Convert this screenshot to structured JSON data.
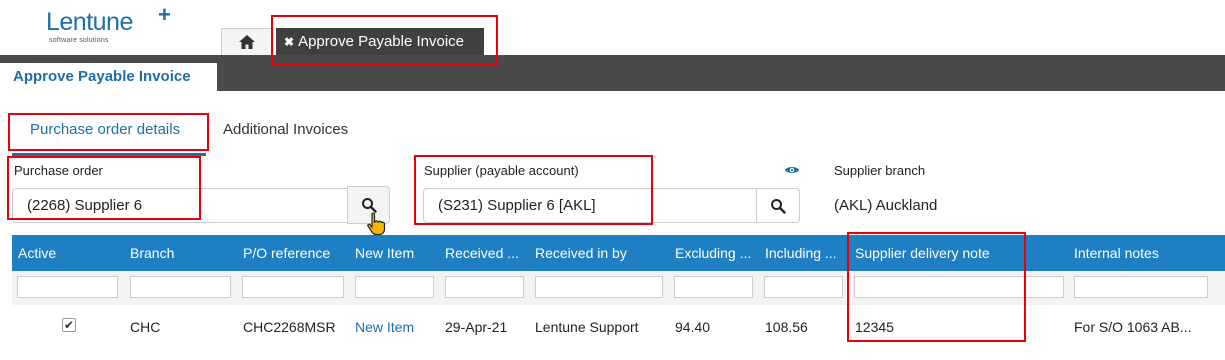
{
  "logo": {
    "name": "Lentune",
    "plus": "+",
    "tagline": "software solutions"
  },
  "top_tabs": {
    "page_tab_label": "Approve Payable Invoice",
    "close_glyph": "✖"
  },
  "header": {
    "title": "Approve Payable Invoice"
  },
  "sub_tabs": {
    "active": "Purchase order details",
    "other": "Additional Invoices"
  },
  "form": {
    "purchase_order_label": "Purchase order",
    "purchase_order_value": "(2268) Supplier 6",
    "supplier_label": "Supplier (payable account)",
    "supplier_value": "(S231) Supplier 6 [AKL]",
    "supplier_branch_label": "Supplier branch",
    "supplier_branch_value": "(AKL) Auckland"
  },
  "table": {
    "columns": [
      "Active",
      "Branch",
      "P/O reference",
      "New Item",
      "Received ...",
      "Received in by",
      "Excluding ...",
      "Including ...",
      "Supplier delivery note",
      "Internal notes"
    ],
    "rows": [
      {
        "active": "✔",
        "branch": "CHC",
        "po_reference": "CHC2268MSR",
        "new_item": "New Item",
        "received": "29-Apr-21",
        "received_by": "Lentune Support",
        "excluding": "94.40",
        "including": "108.56",
        "delivery_note": "12345",
        "internal_notes": "For S/O 1063 AB..."
      }
    ]
  },
  "colors": {
    "brand": "#1e6fa8",
    "table_header": "#1e7fc2",
    "header_bar": "#4a4a4a",
    "annotation": "#e8000b"
  },
  "icons": [
    "home-icon",
    "close-icon",
    "search-icon",
    "eye-icon",
    "hand-cursor-icon",
    "check-icon"
  ]
}
